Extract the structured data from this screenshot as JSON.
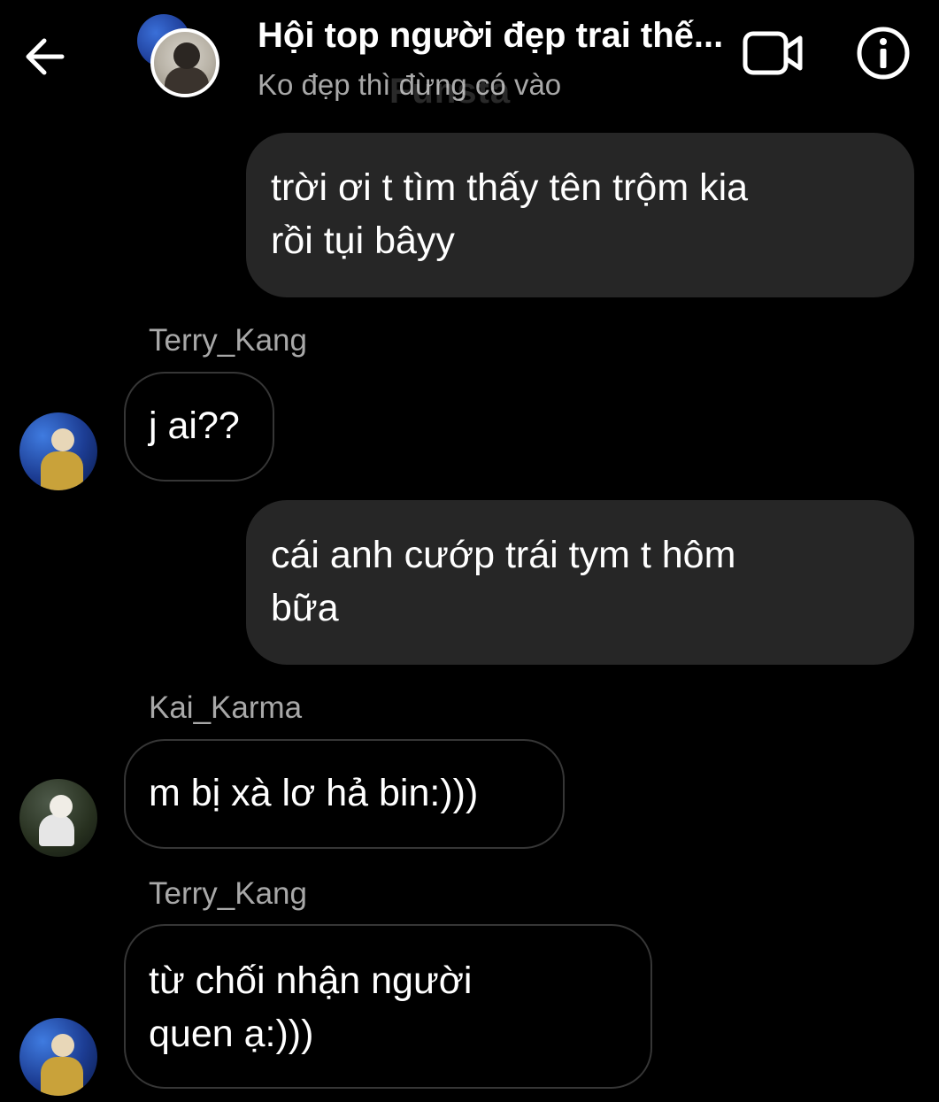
{
  "header": {
    "title": "Hội top người đẹp trai thế...",
    "subtitle": "Ko đẹp thì đừng có vào",
    "watermark": "Funsta"
  },
  "messages": [
    {
      "direction": "outgoing",
      "lines": [
        "trời ơi t tìm thấy tên trộm kia",
        "rồi tụi bâyy"
      ]
    },
    {
      "direction": "incoming",
      "sender": "Terry_Kang",
      "lines": [
        "j ai??"
      ]
    },
    {
      "direction": "outgoing",
      "lines": [
        "cái anh cướp trái tym t hôm",
        "bữa"
      ]
    },
    {
      "direction": "incoming",
      "sender": "Kai_Karma",
      "lines": [
        "m bị xà lơ hả bin:)))"
      ]
    },
    {
      "direction": "incoming",
      "sender": "Terry_Kang",
      "lines": [
        "từ chối nhận người",
        "quen ạ:)))"
      ]
    }
  ],
  "icons": {
    "back": "arrow-left-icon",
    "video": "video-camera-icon",
    "info": "info-circle-icon"
  },
  "colors": {
    "background": "#000000",
    "outgoing_bubble": "#262626",
    "incoming_border": "#363636",
    "secondary_text": "#a8a8a8"
  }
}
